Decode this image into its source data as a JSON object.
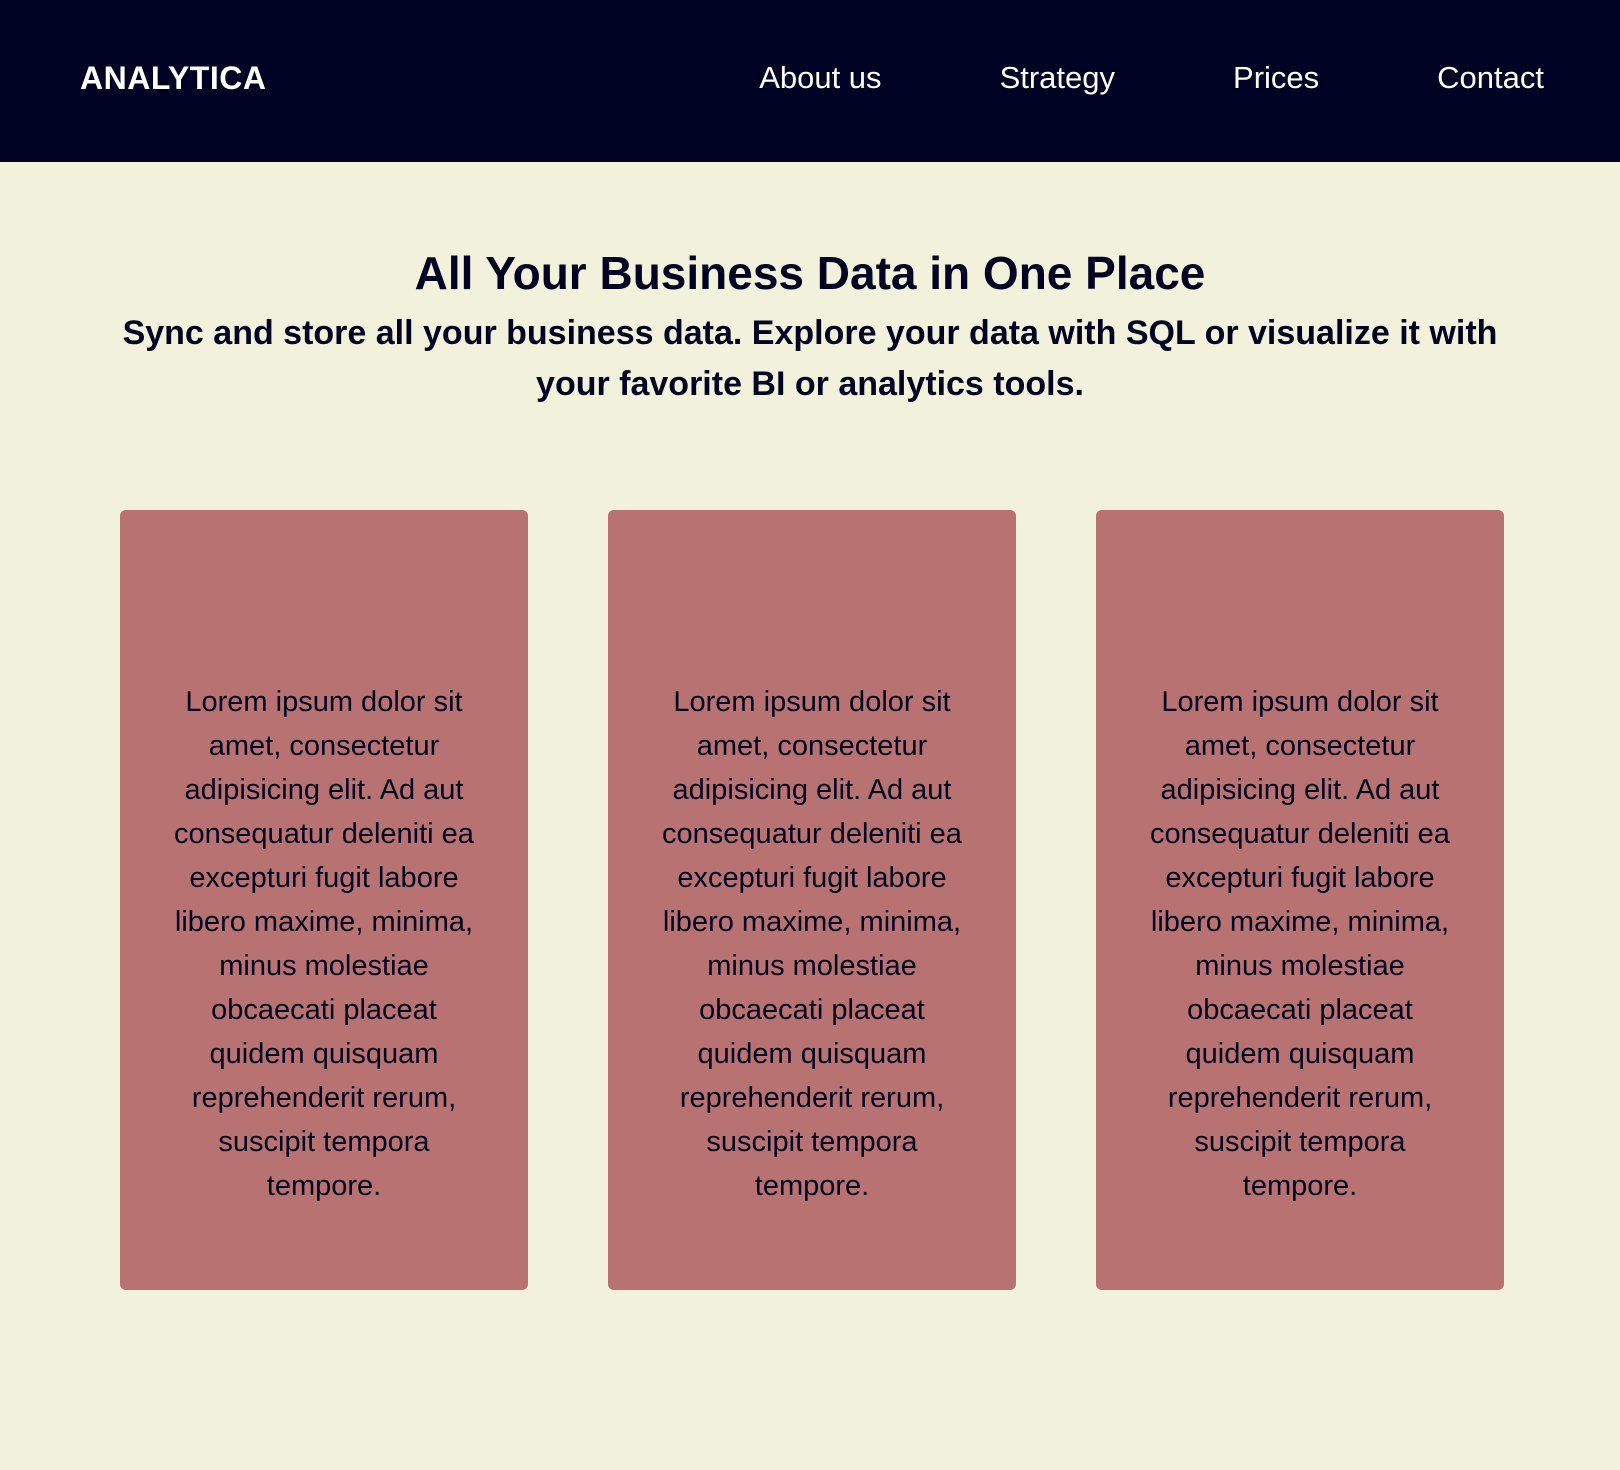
{
  "header": {
    "brand": "ANALYTICA",
    "nav": [
      {
        "label": "About us"
      },
      {
        "label": "Strategy"
      },
      {
        "label": "Prices"
      },
      {
        "label": "Contact"
      }
    ]
  },
  "hero": {
    "title": "All Your Business Data in One Place",
    "subtitle": "Sync and store all your business data. Explore your data with SQL or visualize it with your favorite BI or analytics tools."
  },
  "cards": [
    {
      "text": "Lorem ipsum dolor sit amet, consectetur adipisicing elit. Ad aut consequatur deleniti ea excepturi fugit labore libero maxime, minima, minus molestiae obcaecati placeat quidem quisquam reprehenderit rerum, suscipit tempora tempore."
    },
    {
      "text": "Lorem ipsum dolor sit amet, consectetur adipisicing elit. Ad aut consequatur deleniti ea excepturi fugit labore libero maxime, minima, minus molestiae obcaecati placeat quidem quisquam reprehenderit rerum, suscipit tempora tempore."
    },
    {
      "text": "Lorem ipsum dolor sit amet, consectetur adipisicing elit. Ad aut consequatur deleniti ea excepturi fugit labore libero maxime, minima, minus molestiae obcaecati placeat quidem quisquam reprehenderit rerum, suscipit tempora tempore."
    }
  ],
  "colors": {
    "header_background": "#000223",
    "page_background": "#f2f2dc",
    "card_background": "#b77271",
    "text_dark": "#020322",
    "text_light": "#ffffff"
  }
}
